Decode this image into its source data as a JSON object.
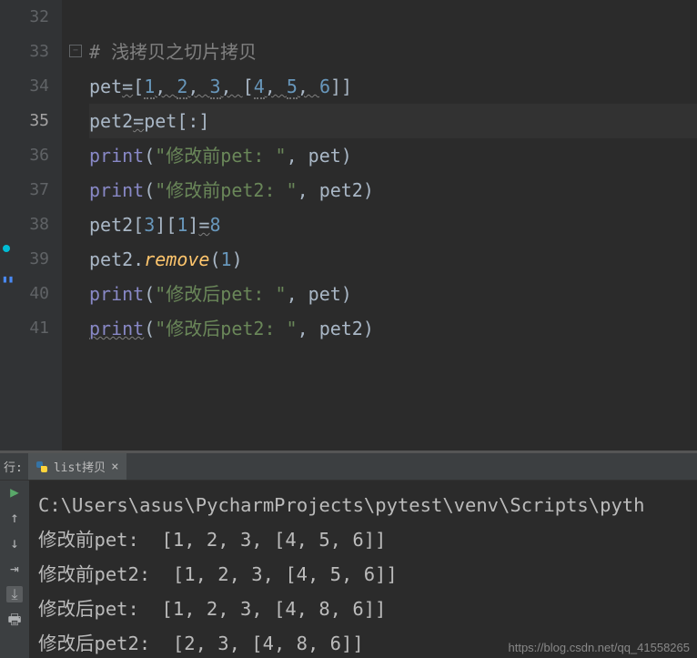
{
  "lineNumbers": [
    "32",
    "33",
    "34",
    "35",
    "36",
    "37",
    "38",
    "39",
    "40",
    "41"
  ],
  "activeLine": "35",
  "code": {
    "l33": {
      "comment": "# 浅拷贝之切片拷贝"
    },
    "l34": {
      "a": "pet",
      "eq": "=",
      "b1": "[",
      "n1": "1",
      "c": ", ",
      "n2": "2",
      "n3": "3",
      "b2": "[",
      "n4": "4",
      "n5": "5",
      "n6": "6",
      "b3": "]]"
    },
    "l35": {
      "a": "pet2",
      "eq": "=",
      "b": "pet",
      "br": "[:]"
    },
    "l36": {
      "p": "print",
      "op": "(",
      "s": "\"修改前pet: \"",
      "cm": ", ",
      "v": "pet",
      "cp": ")"
    },
    "l37": {
      "p": "print",
      "op": "(",
      "s": "\"修改前pet2: \"",
      "cm": ", ",
      "v": "pet2",
      "cp": ")"
    },
    "l38": {
      "a": "pet2",
      "i1": "[",
      "n1": "3",
      "i2": "][",
      "n2": "1",
      "i3": "]",
      "eq": "=",
      "n3": "8"
    },
    "l39": {
      "a": "pet2.",
      "m": "remove",
      "op": "(",
      "n": "1",
      "cp": ")"
    },
    "l40": {
      "p": "print",
      "op": "(",
      "s": "\"修改后pet: \"",
      "cm": ", ",
      "v": "pet",
      "cp": ")"
    },
    "l41": {
      "p": "print",
      "op": "(",
      "s": "\"修改后pet2: \"",
      "cm": ", ",
      "v": "pet2",
      "cp": ")"
    }
  },
  "run": {
    "label": "行:",
    "tabName": "list拷贝"
  },
  "output": {
    "l1": "C:\\Users\\asus\\PycharmProjects\\pytest\\venv\\Scripts\\pyth",
    "l2": "修改前pet:  [1, 2, 3, [4, 5, 6]]",
    "l3": "修改前pet2:  [1, 2, 3, [4, 5, 6]]",
    "l4": "修改后pet:  [1, 2, 3, [4, 8, 6]]",
    "l5": "修改后pet2:  [2, 3, [4, 8, 6]]"
  },
  "watermark": "https://blog.csdn.net/qq_41558265"
}
